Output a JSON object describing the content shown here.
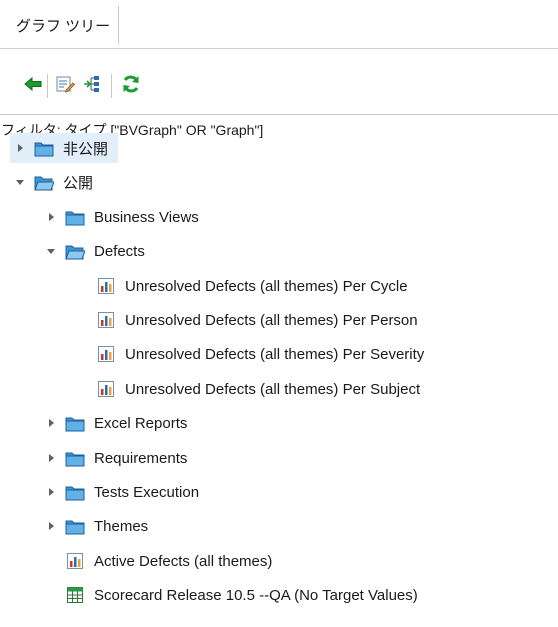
{
  "tabs": [
    {
      "label": "グラフ ツリー"
    }
  ],
  "toolbar": {
    "buttons": [
      {
        "name": "back-arrow-icon"
      },
      {
        "name": "edit-list-icon"
      },
      {
        "name": "tree-structure-icon"
      },
      {
        "name": "refresh-icon"
      }
    ]
  },
  "filter": {
    "text": "フィルタ: タイプ [\"BVGraph\" OR \"Graph\"]"
  },
  "tree": {
    "items": [
      {
        "label": "非公開",
        "type": "folder",
        "level": 0,
        "expander": "collapsed",
        "selected": true
      },
      {
        "label": "公開",
        "type": "folder-open",
        "level": 0,
        "expander": "expanded"
      },
      {
        "label": "Business Views",
        "type": "folder",
        "level": 1,
        "expander": "collapsed"
      },
      {
        "label": "Defects",
        "type": "folder-open",
        "level": 1,
        "expander": "expanded"
      },
      {
        "label": "Unresolved Defects (all themes) Per Cycle",
        "type": "graph",
        "level": 2
      },
      {
        "label": "Unresolved Defects (all themes) Per Person",
        "type": "graph",
        "level": 2
      },
      {
        "label": "Unresolved Defects (all themes) Per Severity",
        "type": "graph",
        "level": 2
      },
      {
        "label": "Unresolved Defects (all themes) Per Subject",
        "type": "graph",
        "level": 2
      },
      {
        "label": "Excel Reports",
        "type": "folder",
        "level": 1,
        "expander": "collapsed"
      },
      {
        "label": "Requirements",
        "type": "folder",
        "level": 1,
        "expander": "collapsed"
      },
      {
        "label": "Tests Execution",
        "type": "folder",
        "level": 1,
        "expander": "collapsed"
      },
      {
        "label": "Themes",
        "type": "folder",
        "level": 1,
        "expander": "collapsed"
      },
      {
        "label": "Active Defects (all themes)",
        "type": "graph",
        "level": 1
      },
      {
        "label": "Scorecard Release 10.5 --QA (No Target Values)",
        "type": "scorecard",
        "level": 1
      }
    ]
  },
  "colors": {
    "selection": "#e3eefb",
    "folder": "#3d95d6",
    "arrow_green": "#1e9b2e",
    "bar_red": "#d0312d",
    "bar_blue": "#2a6db5"
  }
}
